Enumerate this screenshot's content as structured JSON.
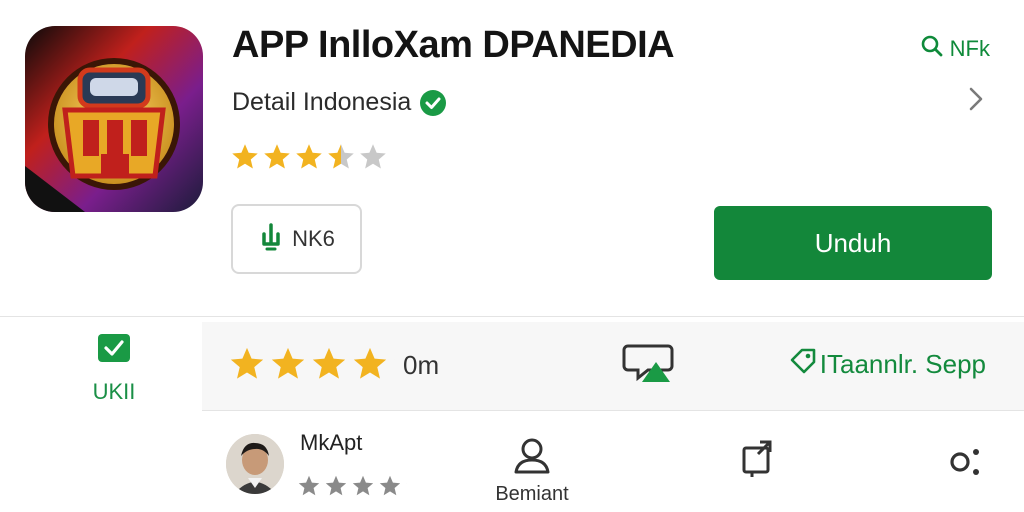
{
  "app": {
    "title": "APP InlloXam DPANEDIA",
    "developer": "Detail Indonesia",
    "rating_stars": 3.5
  },
  "header": {
    "search_label": "NFk",
    "search_icon": "search-icon",
    "chevron_icon": "chevron-right-icon"
  },
  "size_chip": {
    "label": "NK6",
    "icon": "download-icon"
  },
  "install_button": {
    "label": "Unduh"
  },
  "stats": {
    "left_label": "UKII",
    "left_icon": "checkbox-icon",
    "stars": 4,
    "count_label": "0m",
    "tag_label": "ITaannlr. Sepp"
  },
  "review": {
    "reviewer_name": "MkApt",
    "stars": 4,
    "profile_label": "Bemiant"
  },
  "colors": {
    "accent": "#13873a",
    "star": "#f2b320",
    "star_empty": "#c8c8c8",
    "star_gray": "#8a8a8a"
  }
}
